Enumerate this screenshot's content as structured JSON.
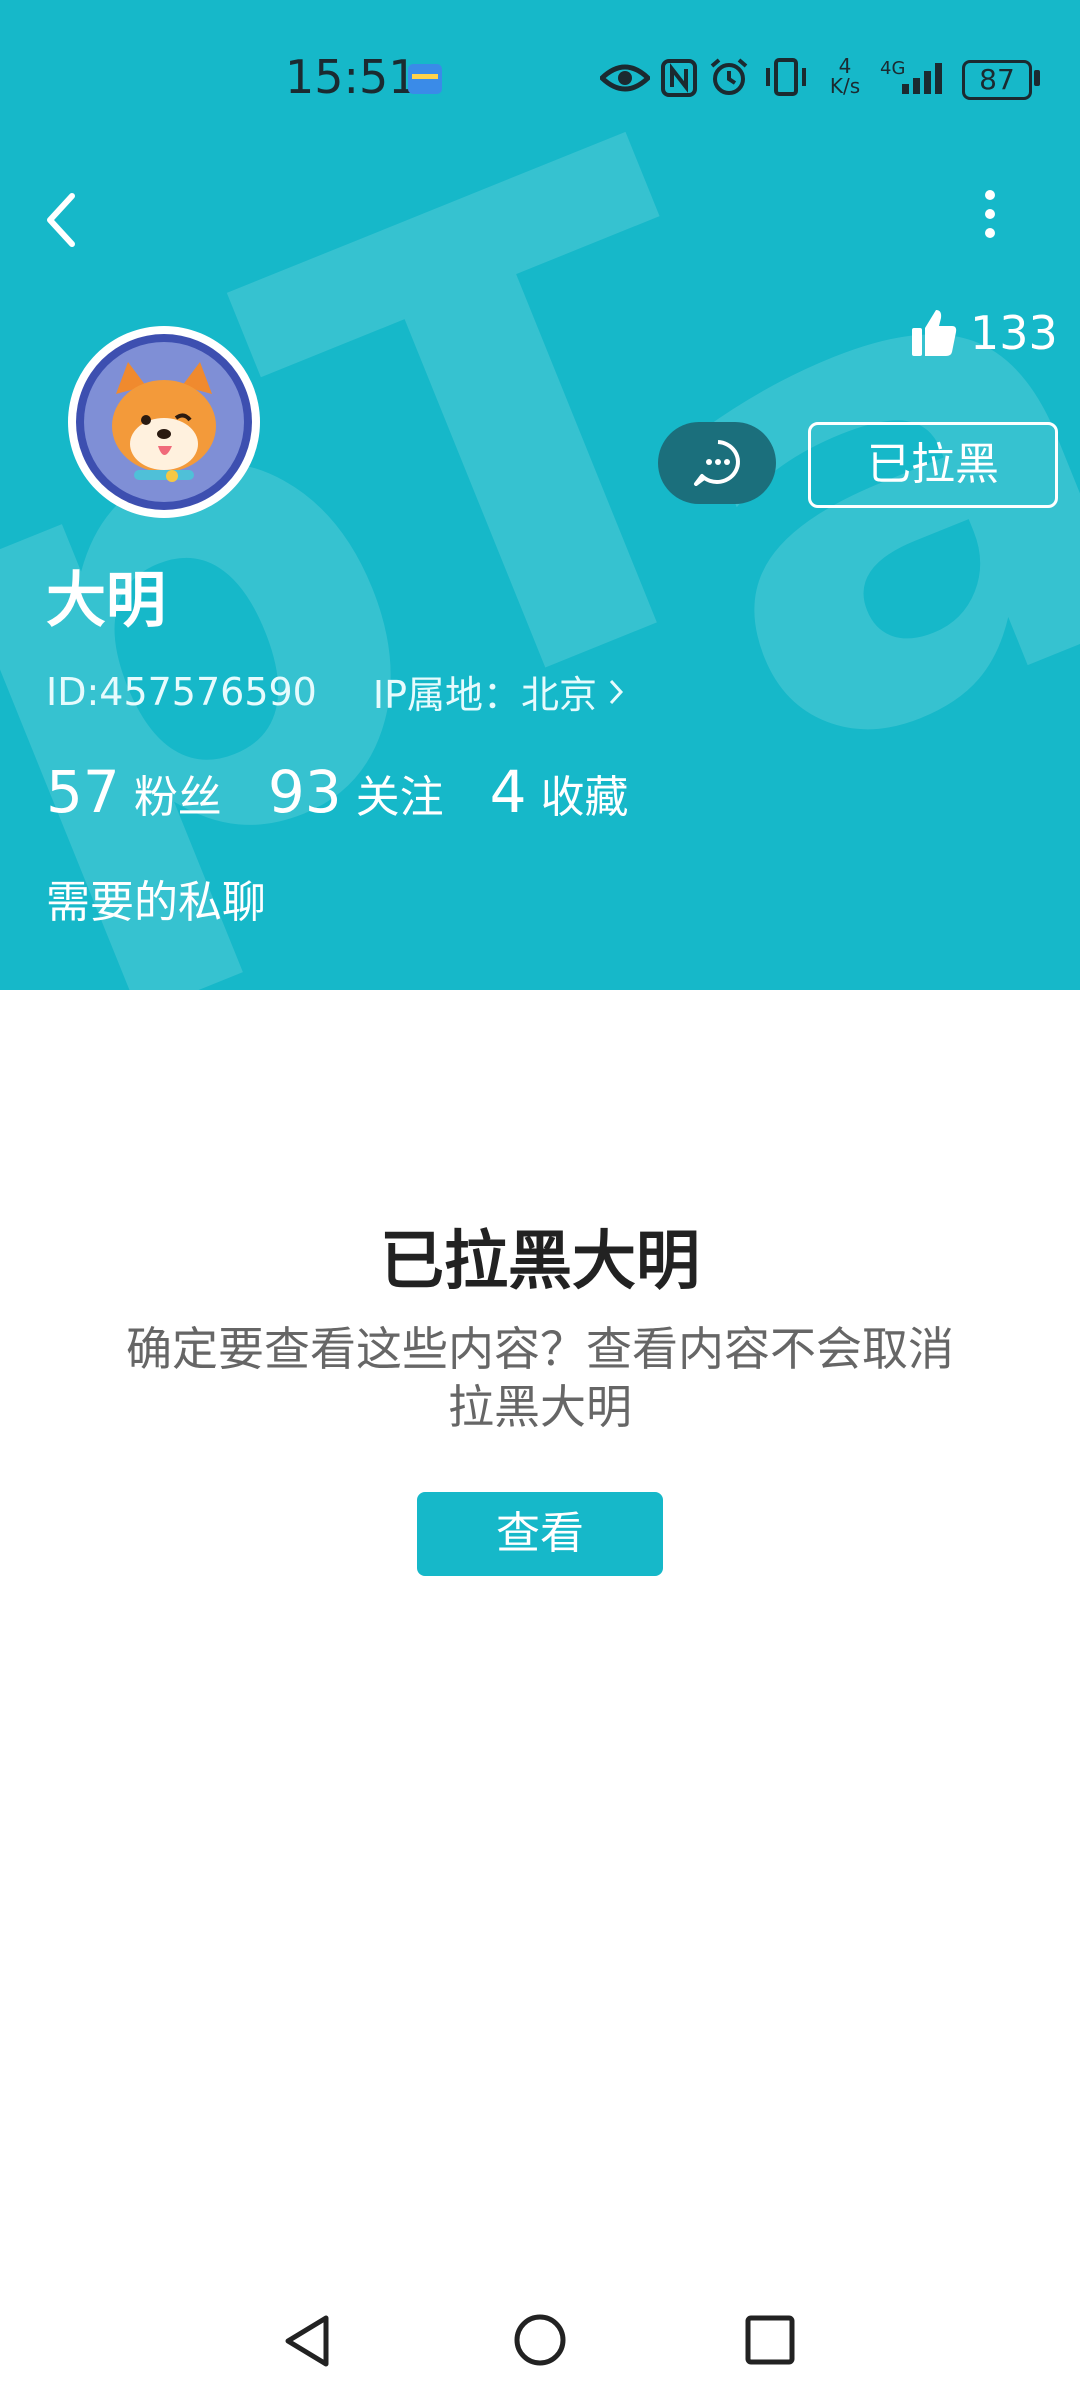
{
  "status_bar": {
    "time": "15:51",
    "net_speed_value": "4",
    "net_speed_unit": "K/s",
    "network_type": "4G",
    "battery_level": "87"
  },
  "header": {
    "like_count": "133",
    "block_button_label": "已拉黑",
    "user_name": "大明",
    "user_id": "ID:457576590",
    "ip_location": "IP属地：北京",
    "stats": [
      {
        "count": "57",
        "label": "粉丝"
      },
      {
        "count": "93",
        "label": "关注"
      },
      {
        "count": "4",
        "label": "收藏"
      }
    ],
    "bio": "需要的私聊"
  },
  "blocked_notice": {
    "title": "已拉黑大明",
    "description": "确定要查看这些内容？查看内容不会取消拉黑大明",
    "view_button_label": "查看"
  },
  "colors": {
    "header_bg": "#16b8c9",
    "button_bg": "#16b8c9",
    "chat_button_bg": "#1b6f7c"
  },
  "icons": [
    "status-notification-icon",
    "eye-icon",
    "nfc-icon",
    "alarm-icon",
    "vibrate-icon",
    "signal-icon",
    "battery-icon",
    "back-arrow-icon",
    "more-vertical-icon",
    "thumbs-up-icon",
    "chat-bubble-icon",
    "chevron-right-icon",
    "nav-back-icon",
    "nav-home-icon",
    "nav-recents-icon"
  ]
}
